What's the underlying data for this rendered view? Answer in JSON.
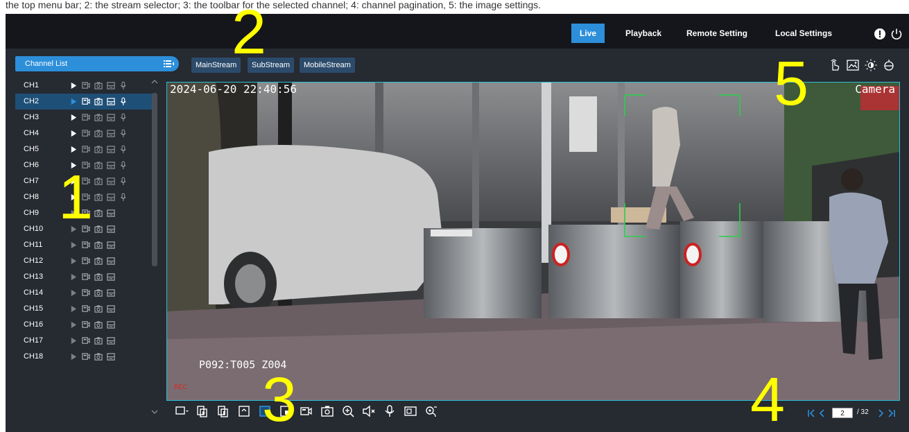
{
  "caption_strip": "the top menu bar; 2: the stream selector; 3: the toolbar for the selected channel; 4: channel pagination, 5: the image settings.",
  "nav": {
    "live": "Live",
    "playback": "Playback",
    "remote_setting": "Remote Setting",
    "local_settings": "Local Settings"
  },
  "channel_list": {
    "header": "Channel List",
    "selected_channel": "CH2",
    "channels": [
      "CH1",
      "CH2",
      "CH3",
      "CH4",
      "CH5",
      "CH6",
      "CH7",
      "CH8",
      "CH9",
      "CH10",
      "CH11",
      "CH12",
      "CH13",
      "CH14",
      "CH15",
      "CH16",
      "CH17",
      "CH18"
    ]
  },
  "streams": {
    "main": "MainStream",
    "sub": "SubStream",
    "mobile": "MobileStream",
    "active": "MainStream"
  },
  "video": {
    "timestamp": "2024-06-20 22:40:56",
    "camera_label": "Camera",
    "ptz_overlay": "P092:T005 Z004",
    "rec_indicator": "REC"
  },
  "pagination": {
    "current_page": "2",
    "total": "/ 32"
  },
  "callouts": [
    "1",
    "2",
    "3",
    "4",
    "5"
  ],
  "colors": {
    "accent": "#2d8fd9",
    "background": "#14161b",
    "panel": "#262a31",
    "video_border": "#29c0d8",
    "callout": "#ffff00"
  },
  "icons": {
    "top": [
      "alert-icon",
      "power-icon"
    ],
    "channel_row": [
      "play-icon",
      "record-icon",
      "snapshot-icon",
      "screen-icon",
      "microphone-icon"
    ],
    "image_settings": [
      "manual-touch-icon",
      "image-adjust-icon",
      "brightness-icon",
      "ptz-icon"
    ],
    "toolbar": [
      "layout-select-icon",
      "sequence-icon",
      "playback-icon",
      "fullscreen-icon",
      "zoom-window-icon",
      "pip-icon",
      "record-icon",
      "snapshot-icon",
      "zoom-icon",
      "mute-icon",
      "microphone-icon",
      "display-ratio-icon",
      "fisheye-icon"
    ]
  }
}
